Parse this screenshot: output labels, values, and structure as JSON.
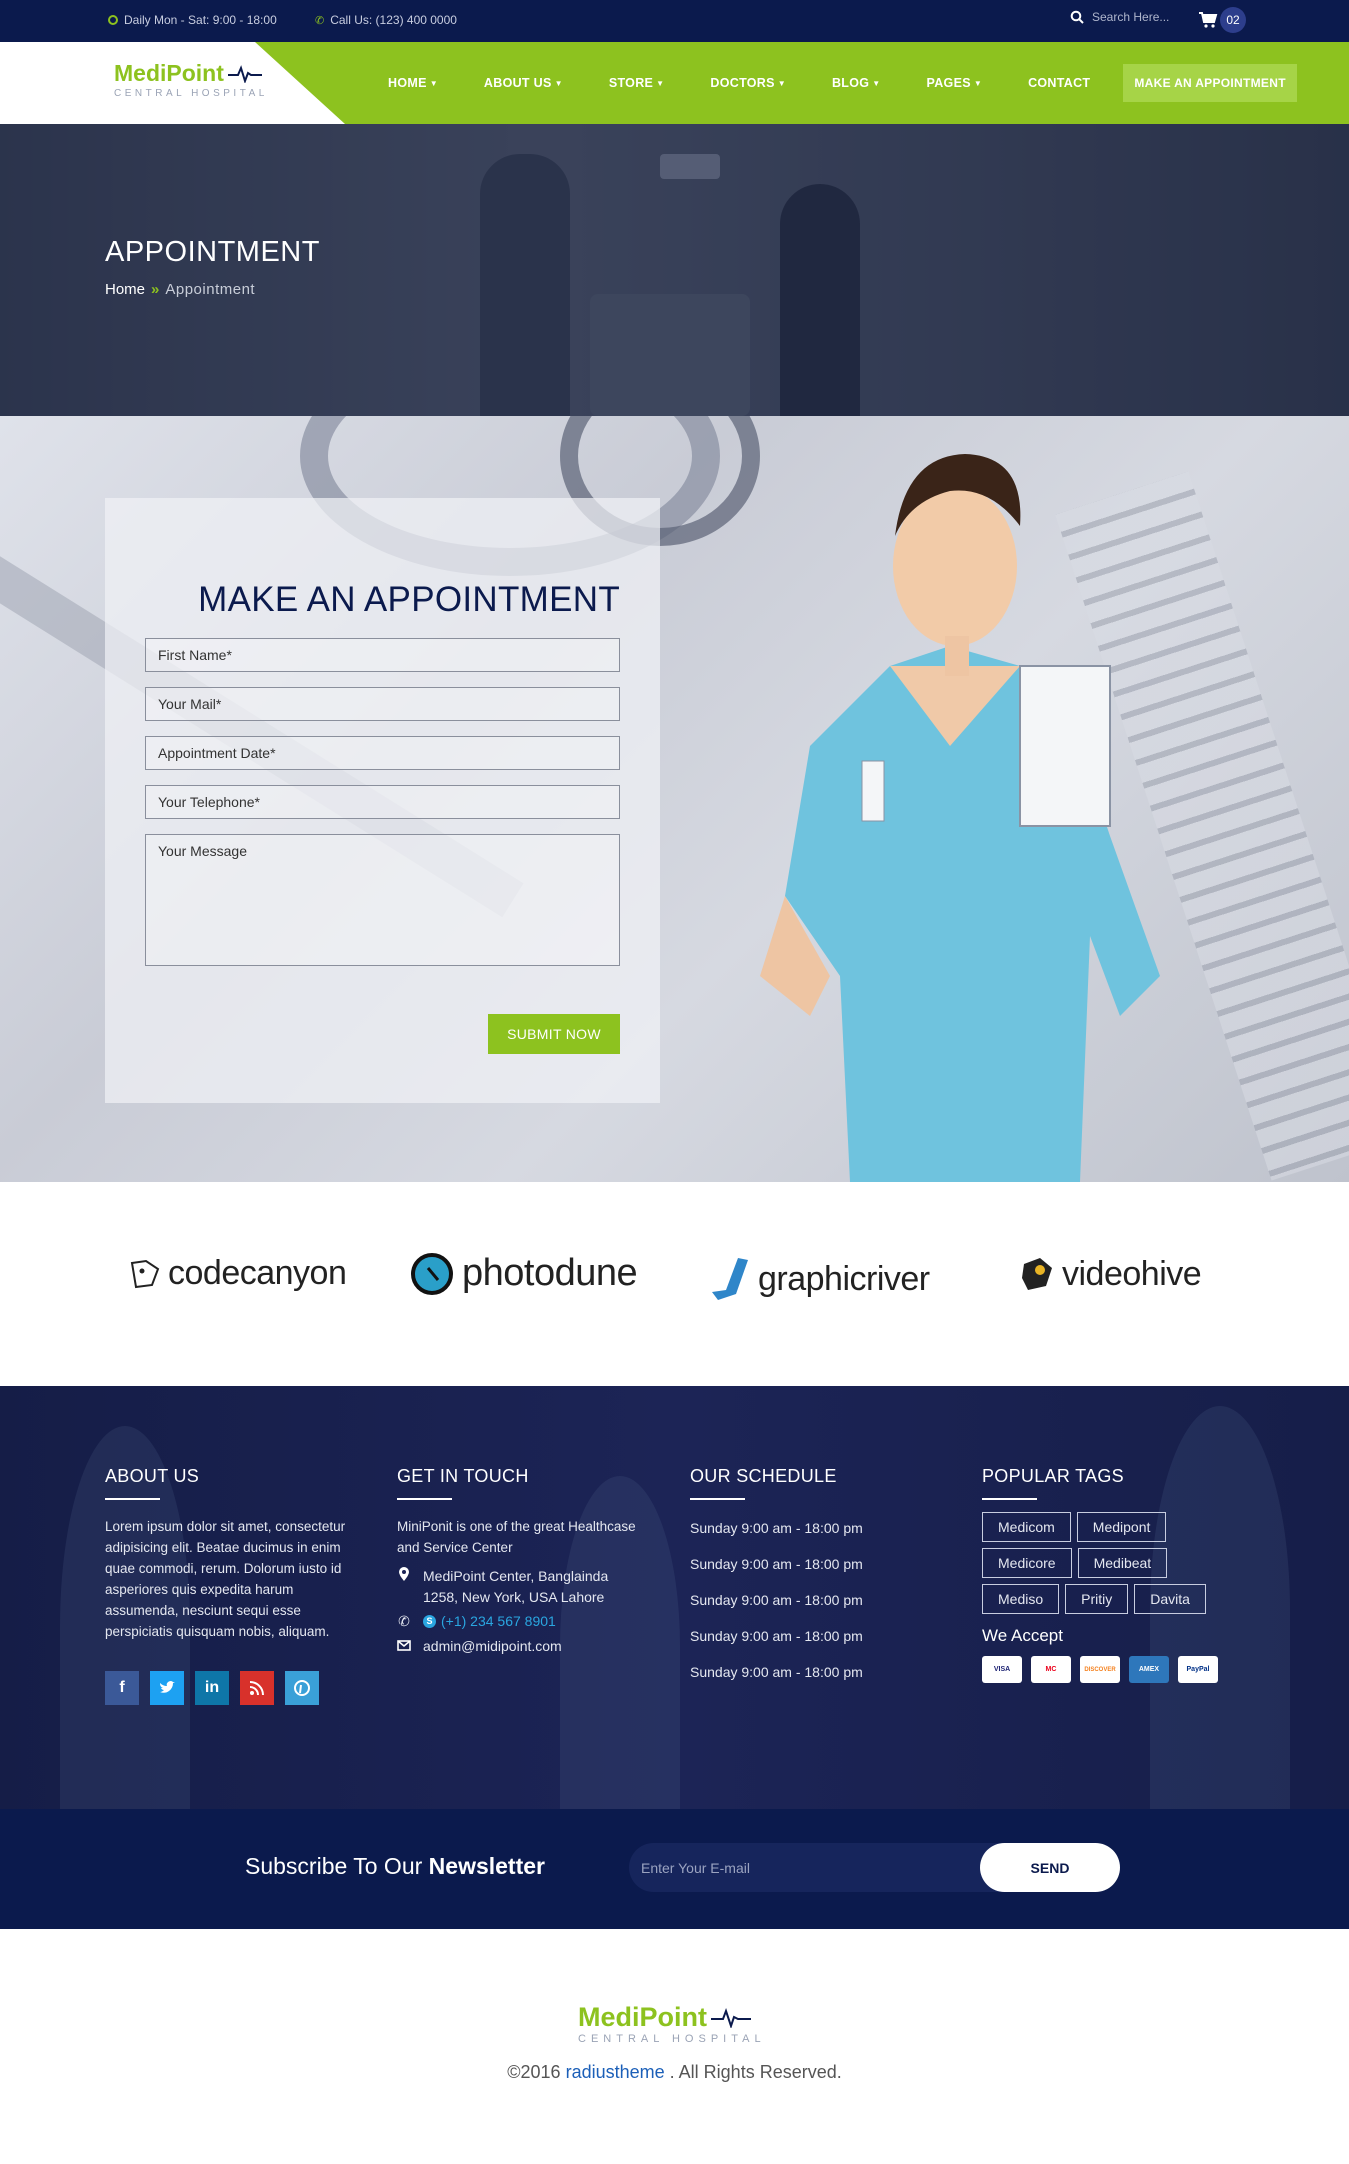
{
  "topbar": {
    "hours": "Daily Mon - Sat: 9:00 - 18:00",
    "call": "Call Us: (123) 400 0000",
    "search_placeholder": "Search Here...",
    "cart_count": "02"
  },
  "brand": {
    "name": "MediPoint",
    "tagline": "CENTRAL HOSPITAL"
  },
  "nav": {
    "items": [
      "HOME",
      "ABOUT US",
      "STORE",
      "DOCTORS",
      "BLOG",
      "PAGES",
      "CONTACT"
    ],
    "cta": "MAKE AN APPOINTMENT"
  },
  "hero": {
    "title": "APPOINTMENT",
    "breadcrumb_home": "Home",
    "breadcrumb_sep": "»",
    "breadcrumb_current": "Appointment"
  },
  "form": {
    "title": "MAKE AN APPOINTMENT",
    "first_name": "First Name*",
    "mail": "Your Mail*",
    "date": "Appointment Date*",
    "phone": "Your Telephone*",
    "message": "Your Message",
    "submit": "SUBMIT NOW"
  },
  "partners": [
    "codecanyon",
    "photodune",
    "graphicriver",
    "videohive"
  ],
  "footer": {
    "about": {
      "title": "ABOUT US",
      "text": "Lorem ipsum dolor sit amet, consectetur adipisicing elit. Beatae ducimus in enim quae commodi, rerum. Dolorum iusto id asperiores quis expedita harum assumenda, nesciunt sequi esse perspiciatis quisquam nobis, aliquam."
    },
    "touch": {
      "title": "GET IN TOUCH",
      "intro": "MiniPonit is one of the great Healthcase and Service Center",
      "address": "MediPoint Center, Banglainda 1258, New York, USA Lahore",
      "phone": "(+1) 234 567 8901",
      "email": "admin@midipoint.com"
    },
    "schedule": {
      "title": "OUR SCHEDULE",
      "rows": [
        "Sunday 9:00 am - 18:00 pm",
        "Sunday 9:00 am - 18:00 pm",
        "Sunday 9:00 am - 18:00 pm",
        "Sunday 9:00 am - 18:00 pm",
        "Sunday 9:00 am - 18:00 pm"
      ]
    },
    "tags": {
      "title": "POPULAR TAGS",
      "items": [
        "Medicom",
        "Medipont",
        "Medicore",
        "Medibeat",
        "Mediso",
        "Pritiy",
        "Davita"
      ]
    },
    "accept": "We Accept",
    "cards": [
      "VISA",
      "MC",
      "DISCOVER",
      "AMEX",
      "PayPal"
    ]
  },
  "social_icons": [
    "facebook-icon",
    "twitter-icon",
    "linkedin-icon",
    "rss-icon",
    "pinterest-icon"
  ],
  "newsletter": {
    "label_prefix": "Subscribe To Our",
    "label_bold": "Newsletter",
    "placeholder": "Enter Your E-mail",
    "send": "SEND"
  },
  "bottom": {
    "copy": "©2016",
    "link": "radiustheme",
    "rights": ". All Rights Reserved."
  },
  "colors": {
    "primary_green": "#8dc21f",
    "navy": "#0b1a4d",
    "facebook": "#3b5998",
    "twitter": "#1da1f2",
    "linkedin": "#0e76a8",
    "rss": "#d8312b",
    "pinterest": "#3aa0d8"
  }
}
